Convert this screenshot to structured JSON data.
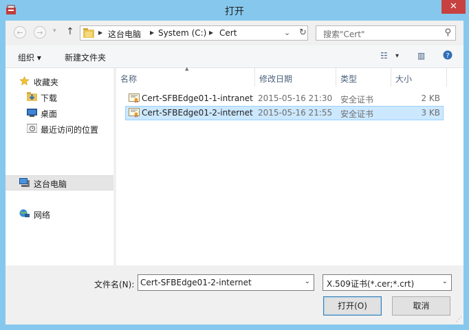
{
  "window": {
    "title": "打开",
    "close_glyph": "✕"
  },
  "address": {
    "crumbs": [
      "这台电脑",
      "System (C:)",
      "Cert"
    ]
  },
  "search": {
    "placeholder": "搜索\"Cert\""
  },
  "toolbar": {
    "organize": "组织 ▾",
    "new_folder": "新建文件夹"
  },
  "nav_pane": {
    "items": [
      {
        "label": "收藏夹",
        "icon": "star-icon"
      },
      {
        "label": "下载",
        "icon": "downloads-folder-icon"
      },
      {
        "label": "桌面",
        "icon": "desktop-icon"
      },
      {
        "label": "最近访问的位置",
        "icon": "recent-places-icon"
      },
      {
        "label": "这台电脑",
        "icon": "computer-icon",
        "selected": true
      },
      {
        "label": "网络",
        "icon": "network-icon"
      }
    ]
  },
  "columns": [
    "名称",
    "修改日期",
    "类型",
    "大小"
  ],
  "files": [
    {
      "name": "Cert-SFBEdge01-1-intranet",
      "date": "2015-05-16 21:30",
      "type": "安全证书",
      "size": "2 KB",
      "selected": false
    },
    {
      "name": "Cert-SFBEdge01-2-internet",
      "date": "2015-05-16 21:55",
      "type": "安全证书",
      "size": "3 KB",
      "selected": true
    }
  ],
  "bottom": {
    "filename_label": "文件名(N):",
    "filename_value": "Cert-SFBEdge01-2-internet",
    "filetype_value": "X.509证书(*.cer;*.crt)",
    "open_button": "打开(O)",
    "cancel_button": "取消"
  },
  "colors": {
    "title_bar": "#86c8ed",
    "close": "#c74141",
    "selection": "#cce8ff"
  }
}
